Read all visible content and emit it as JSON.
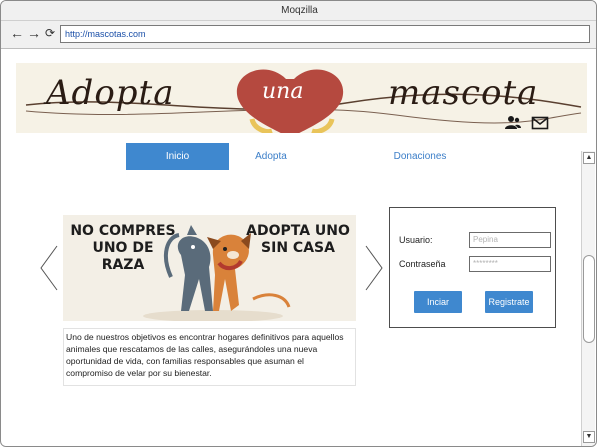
{
  "window": {
    "title": "Moqzilla"
  },
  "browser": {
    "url": "http://mascotas.com"
  },
  "banner": {
    "word_left": "Adopta",
    "word_mid": "una",
    "word_right": "mascota"
  },
  "nav": {
    "tabs": [
      {
        "label": "Inicio"
      },
      {
        "label": "Adopta"
      },
      {
        "label": "Donaciones"
      }
    ],
    "active_tab": "Inicio"
  },
  "promo": {
    "left_line1": "NO COMPRES",
    "left_line2": "UNO DE",
    "left_line3": "RAZA",
    "right_line1": "ADOPTA UNO",
    "right_line2": "SIN CASA",
    "caption": "Uno de nuestros objetivos es encontrar hogares definitivos para aquellos animales que rescatamos de las calles, asegurándoles una nueva oportunidad de vida, con familias responsables que asuman el compromiso de velar por su bienestar."
  },
  "login": {
    "user_label": "Usuario:",
    "user_placeholder": "Pepina",
    "password_label": "Contraseña",
    "password_placeholder": "********",
    "login_button": "Inciar",
    "register_button": "Registrate"
  },
  "colors": {
    "accent": "#3f88cf",
    "link": "#3b7ec8",
    "heart": "#b5493f"
  },
  "icons": [
    "back-arrow-icon",
    "forward-arrow-icon",
    "reload-icon",
    "users-icon",
    "mail-icon",
    "chevron-left-icon",
    "chevron-right-icon",
    "scroll-up-icon",
    "scroll-down-icon"
  ]
}
